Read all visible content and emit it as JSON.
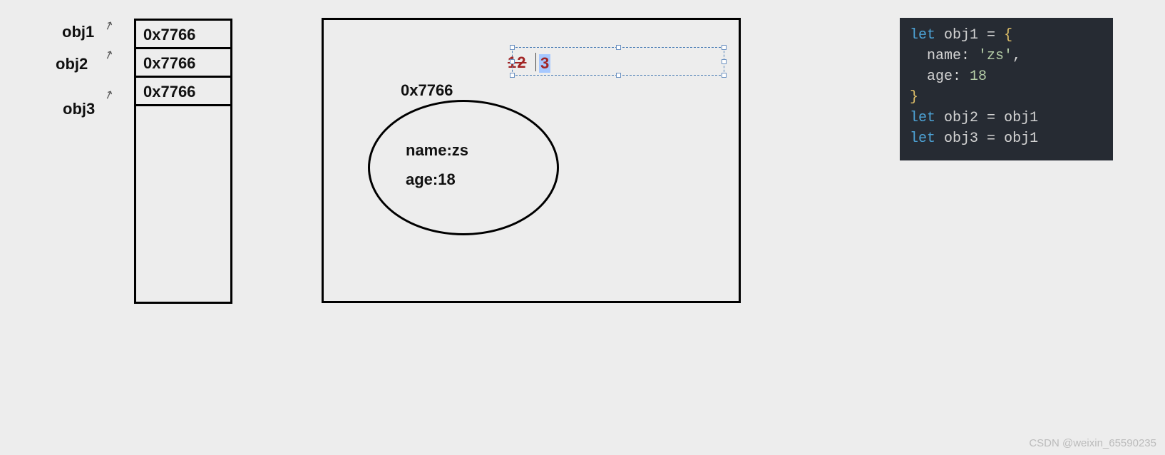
{
  "stack": {
    "labels": {
      "obj1": "obj1",
      "obj2": "obj2",
      "obj3": "obj3"
    },
    "cells": {
      "c1": "0x7766",
      "c2": "0x7766",
      "c3": "0x7766"
    }
  },
  "heap": {
    "address": "0x7766",
    "props": {
      "name": "name:zs",
      "age": "age:18"
    }
  },
  "editing": {
    "old": "12",
    "new": "3"
  },
  "code": {
    "let": "let",
    "obj1": "obj1",
    "obj2": "obj2",
    "obj3": "obj3",
    "eq": " = ",
    "open": "{",
    "close": "}",
    "nameKey": "name",
    "colon": ": ",
    "nameVal": "'zs'",
    "comma": ",",
    "ageKey": "age",
    "ageVal": "18"
  },
  "watermark": "CSDN @weixin_65590235"
}
